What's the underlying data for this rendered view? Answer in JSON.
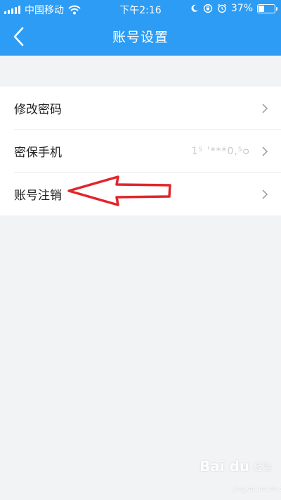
{
  "status_bar": {
    "carrier": "中国移动",
    "time": "下午2:16",
    "battery": "37%",
    "battery_level": 0.37,
    "icons": [
      "signal-icon",
      "wifi-icon",
      "moon-icon",
      "rotation-lock-icon",
      "alarm-icon",
      "battery-icon"
    ]
  },
  "header": {
    "title": "账号设置",
    "back_icon": "chevron-left-icon"
  },
  "settings": {
    "items": [
      {
        "label": "修改密码",
        "value": ""
      },
      {
        "label": "密保手机",
        "value": "1⁵ ˈ***0,⁵ᴑ"
      },
      {
        "label": "账号注销",
        "value": ""
      }
    ]
  },
  "annotation": {
    "color": "#e1252b",
    "icon": "arrow-left-icon"
  },
  "watermark": {
    "brand": "Bai du",
    "sub": "经验",
    "url": "jingyan.baidu.com"
  },
  "colors": {
    "header_bg": "#2d9cf4",
    "page_bg": "#f2f3f5"
  }
}
